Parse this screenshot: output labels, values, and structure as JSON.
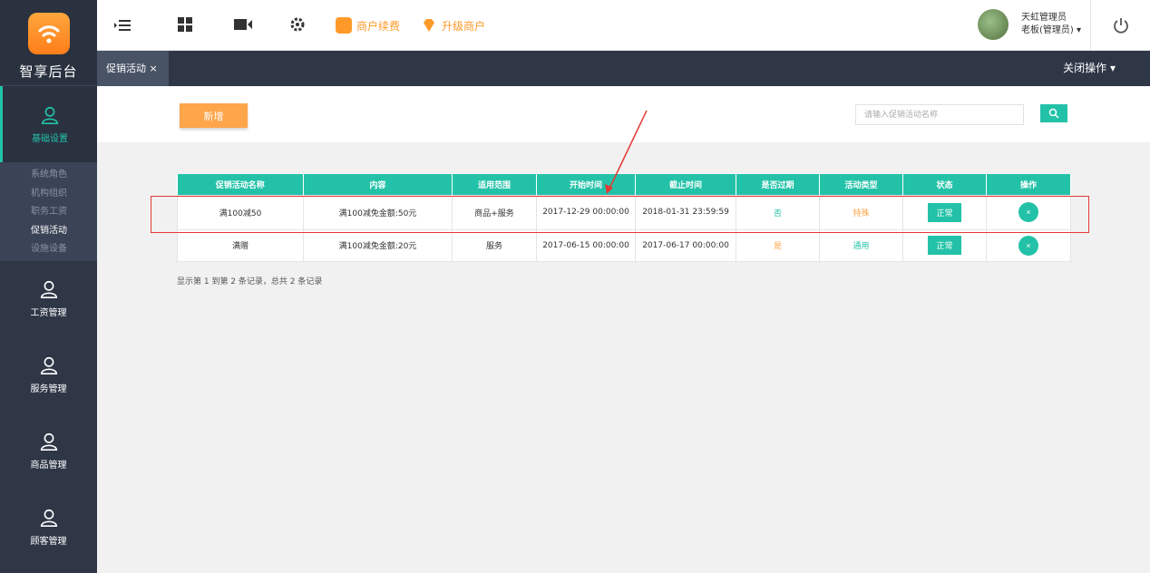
{
  "sidebar": {
    "brand": "智享后台",
    "items": [
      {
        "label": "基础设置",
        "icon": "person-icon",
        "active": true
      },
      {
        "label": "工资管理",
        "icon": "person-icon"
      },
      {
        "label": "服务管理",
        "icon": "person-icon"
      },
      {
        "label": "商品管理",
        "icon": "person-icon"
      },
      {
        "label": "顾客管理",
        "icon": "person-icon"
      }
    ],
    "submenu": [
      "系统角色",
      "机构组织",
      "职务工资",
      "促销活动",
      "设施设备"
    ]
  },
  "topbar": {
    "renew_label": "商户续费",
    "upgrade_label": "升级商户",
    "user_name": "天虹管理员",
    "user_role": "老板(管理员) ▾"
  },
  "tabs": {
    "active_tab": "促销活动 ×",
    "close_ops": "关闭操作 ▾"
  },
  "toolbar": {
    "add_label": "新增",
    "search_placeholder": "请输入促销活动名称"
  },
  "table": {
    "columns": [
      "促销活动名称",
      "内容",
      "适用范围",
      "开始时间",
      "截止时间",
      "是否过期",
      "活动类型",
      "状态",
      "操作"
    ],
    "rows": [
      {
        "name": "满100减50",
        "content": "满100减免金额:50元",
        "scope": "商品+服务",
        "start": "2017-12-29 00:00:00",
        "end": "2018-01-31 23:59:59",
        "expired": "否",
        "type": "特殊",
        "status": "正常",
        "op": "×"
      },
      {
        "name": "满赠",
        "content": "满100减免金额:20元",
        "scope": "服务",
        "start": "2017-06-15 00:00:00",
        "end": "2017-06-17 00:00:00",
        "expired": "是",
        "type": "通用",
        "status": "正常",
        "op": "×"
      }
    ]
  },
  "pager_text": "显示第 1 到第 2 条记录，总共 2 条记录",
  "colors": {
    "accent": "#23c2a8",
    "orange": "#ffa54a",
    "sidebar": "#2f3747",
    "annotation": "#e53935"
  }
}
